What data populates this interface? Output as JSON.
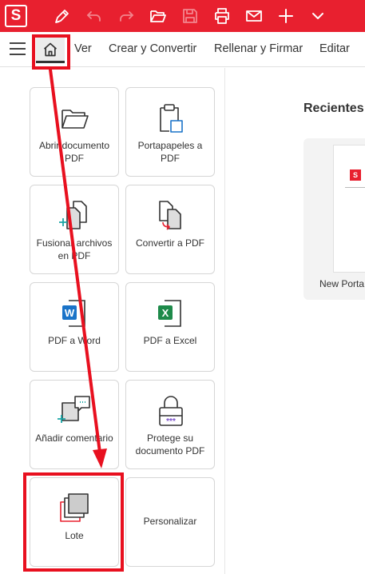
{
  "titlebar": {
    "logo_letter": "S",
    "brand_color": "#e8202f",
    "icons": [
      "pen-icon",
      "undo-icon",
      "redo-icon",
      "open-folder-icon",
      "save-icon",
      "print-icon",
      "mail-icon",
      "plus-icon",
      "chevron-down-icon"
    ]
  },
  "menubar": {
    "items": [
      "Ver",
      "Crear y Convertir",
      "Rellenar y Firmar",
      "Editar"
    ]
  },
  "tiles": [
    {
      "label": "Abrir documento PDF",
      "icon": "folder-icon"
    },
    {
      "label": "Portapapeles a PDF",
      "icon": "clipboard-icon"
    },
    {
      "label": "Fusionar archivos en PDF",
      "icon": "merge-files-icon"
    },
    {
      "label": "Convertir a PDF",
      "icon": "convert-icon"
    },
    {
      "label": "PDF a Word",
      "icon": "word-icon",
      "badge": "W"
    },
    {
      "label": "PDF a Excel",
      "icon": "excel-icon",
      "badge": "X"
    },
    {
      "label": "Añadir comentario",
      "icon": "comment-icon"
    },
    {
      "label": "Protege su documento PDF",
      "icon": "lock-icon",
      "badge": "***"
    },
    {
      "label": "Lote",
      "icon": "batch-icon"
    },
    {
      "label": "Personalizar",
      "icon": ""
    }
  ],
  "recent": {
    "title": "Recientes",
    "items": [
      {
        "name": "New Porta",
        "thumb_letter": "S"
      }
    ]
  },
  "annotation_color": "#e8101f"
}
